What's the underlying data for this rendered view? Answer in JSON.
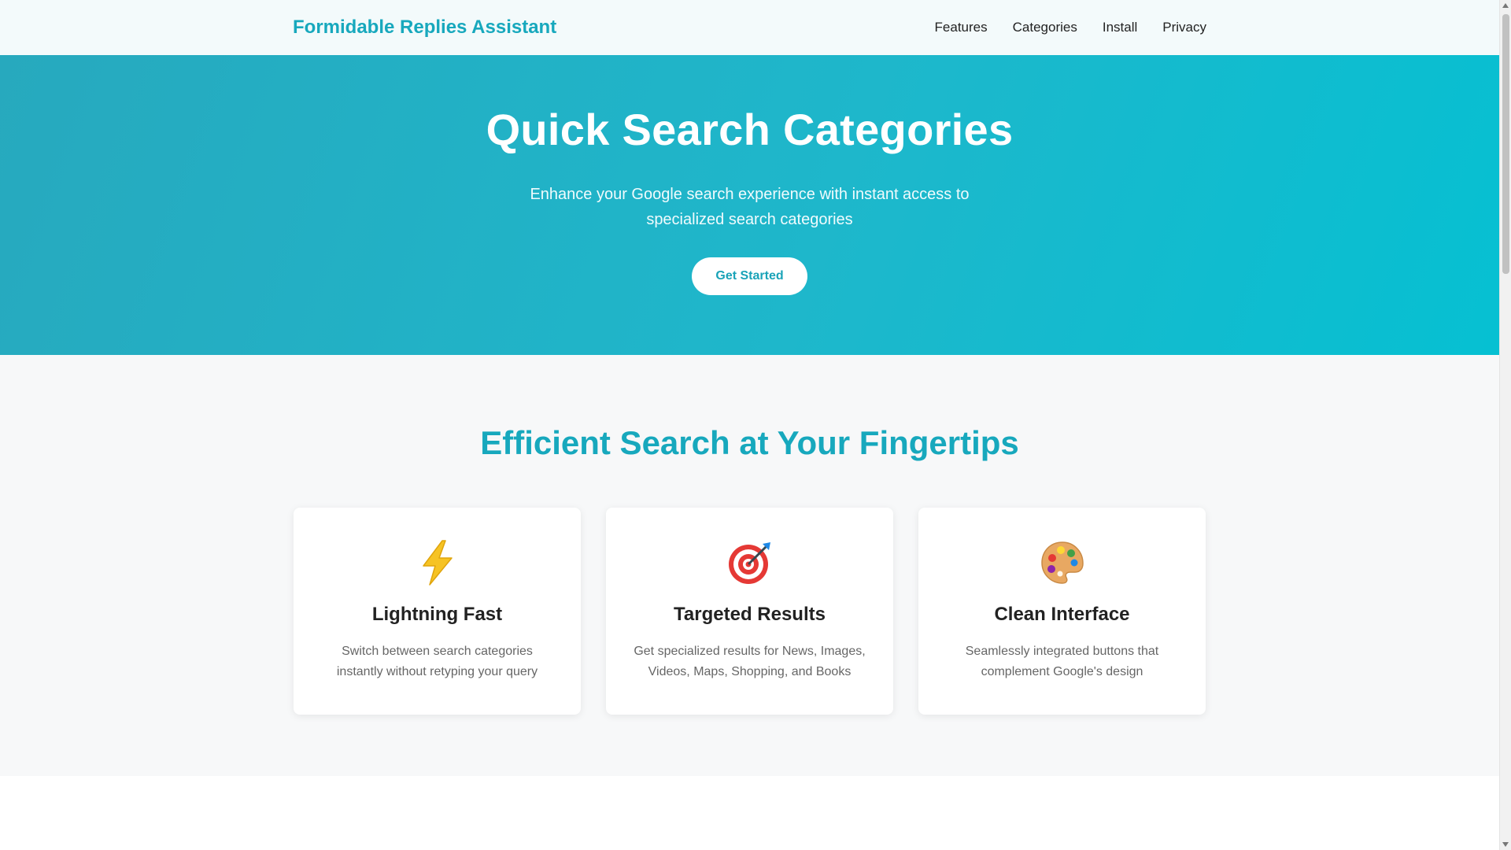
{
  "header": {
    "brand": "Formidable Replies Assistant",
    "nav": [
      "Features",
      "Categories",
      "Install",
      "Privacy"
    ]
  },
  "hero": {
    "title": "Quick Search Categories",
    "subtitle": "Enhance your Google search experience with instant access to specialized search categories",
    "cta_label": "Get Started"
  },
  "features": {
    "heading": "Efficient Search at Your Fingertips",
    "cards": [
      {
        "icon": "lightning-icon",
        "title": "Lightning Fast",
        "text": "Switch between search categories instantly without retyping your query"
      },
      {
        "icon": "target-icon",
        "title": "Targeted Results",
        "text": "Get specialized results for News, Images, Videos, Maps, Shopping, and Books"
      },
      {
        "icon": "palette-icon",
        "title": "Clean Interface",
        "text": "Seamlessly integrated buttons that complement Google's design"
      }
    ]
  },
  "colors": {
    "accent": "#17a8bd",
    "hero_start": "#27a9be",
    "hero_end": "#06c0d2",
    "section_bg": "#f7f8f9"
  }
}
